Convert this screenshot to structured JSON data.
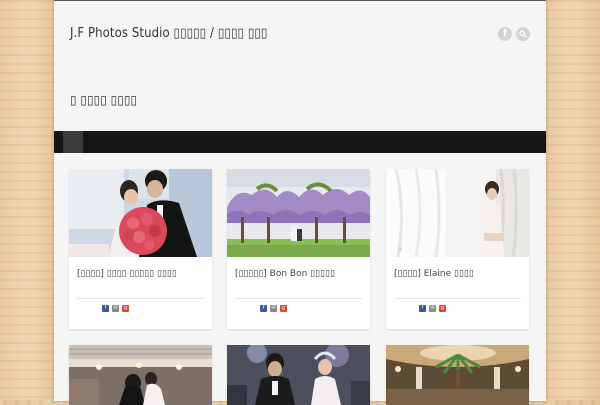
{
  "header": {
    "site_title": "J.F Photos Studio ▯▯▯▯▯ / ▯▯▯▯ ▯▯▯",
    "icons": [
      "facebook-icon",
      "search-icon"
    ]
  },
  "page": {
    "heading": "▯ ▯▯▯▯ ▯▯▯▯"
  },
  "cards": [
    {
      "title": "[▯▯▯▯] ▯▯▯▯ ▯▯▯▯▯ ▯▯▯▯"
    },
    {
      "title": "[▯▯▯▯▯] Bon Bon ▯▯▯▯▯"
    },
    {
      "title": "[▯▯▯▯] Elaine ▯▯▯▯"
    }
  ],
  "share_labels": {
    "facebook": "f",
    "mail": "✉",
    "gplus": "g"
  }
}
